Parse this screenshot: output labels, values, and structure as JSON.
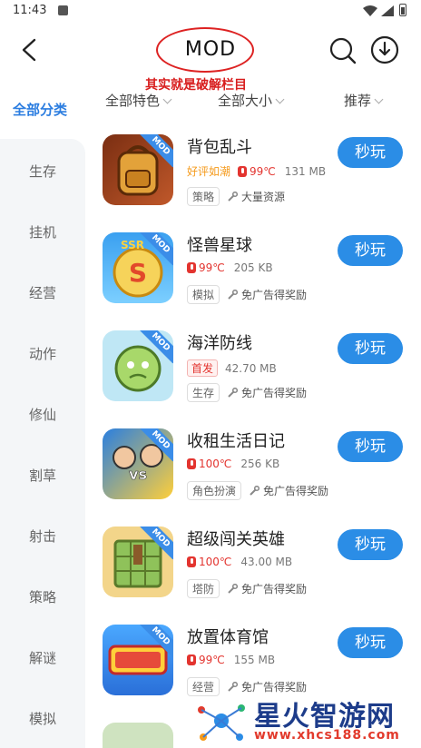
{
  "status": {
    "time": "11:43"
  },
  "header": {
    "title": "MOD",
    "annotation": "其实就是破解栏目"
  },
  "sidebar": {
    "all_label": "全部分类",
    "items": [
      {
        "label": "生存"
      },
      {
        "label": "挂机"
      },
      {
        "label": "经营"
      },
      {
        "label": "动作"
      },
      {
        "label": "修仙"
      },
      {
        "label": "割草"
      },
      {
        "label": "射击"
      },
      {
        "label": "策略"
      },
      {
        "label": "解谜"
      },
      {
        "label": "模拟"
      }
    ]
  },
  "filters": [
    {
      "label": "全部特色"
    },
    {
      "label": "全部大小"
    },
    {
      "label": "推荐"
    }
  ],
  "games": [
    {
      "name": "背包乱斗",
      "badge": "好评如潮",
      "temp": "99℃",
      "size": "131 MB",
      "tag": "策略",
      "feature": "大量资源",
      "button": "秒玩",
      "mod": "MOD"
    },
    {
      "name": "怪兽星球",
      "badge": "",
      "temp": "99℃",
      "size": "205 KB",
      "tag": "模拟",
      "feature": "免广告得奖励",
      "button": "秒玩",
      "mod": "MOD"
    },
    {
      "name": "海洋防线",
      "badge": "首发",
      "temp": "",
      "size": "42.70 MB",
      "tag": "生存",
      "feature": "免广告得奖励",
      "button": "秒玩",
      "mod": "MOD"
    },
    {
      "name": "收租生活日记",
      "badge": "",
      "temp": "100℃",
      "size": "256 KB",
      "tag": "角色扮演",
      "feature": "免广告得奖励",
      "button": "秒玩",
      "mod": "MOD"
    },
    {
      "name": "超级闯关英雄",
      "badge": "",
      "temp": "100℃",
      "size": "43.00 MB",
      "tag": "塔防",
      "feature": "免广告得奖励",
      "button": "秒玩",
      "mod": "MOD"
    },
    {
      "name": "放置体育馆",
      "badge": "",
      "temp": "99℃",
      "size": "155 MB",
      "tag": "经营",
      "feature": "免广告得奖励",
      "button": "秒玩",
      "mod": "MOD"
    }
  ],
  "watermark": {
    "brand": "星火智游网",
    "url": "www.xhcs188.com"
  },
  "colors": {
    "accent": "#2b8de6",
    "hot": "#e3342f",
    "annotation": "#d81e1e"
  }
}
